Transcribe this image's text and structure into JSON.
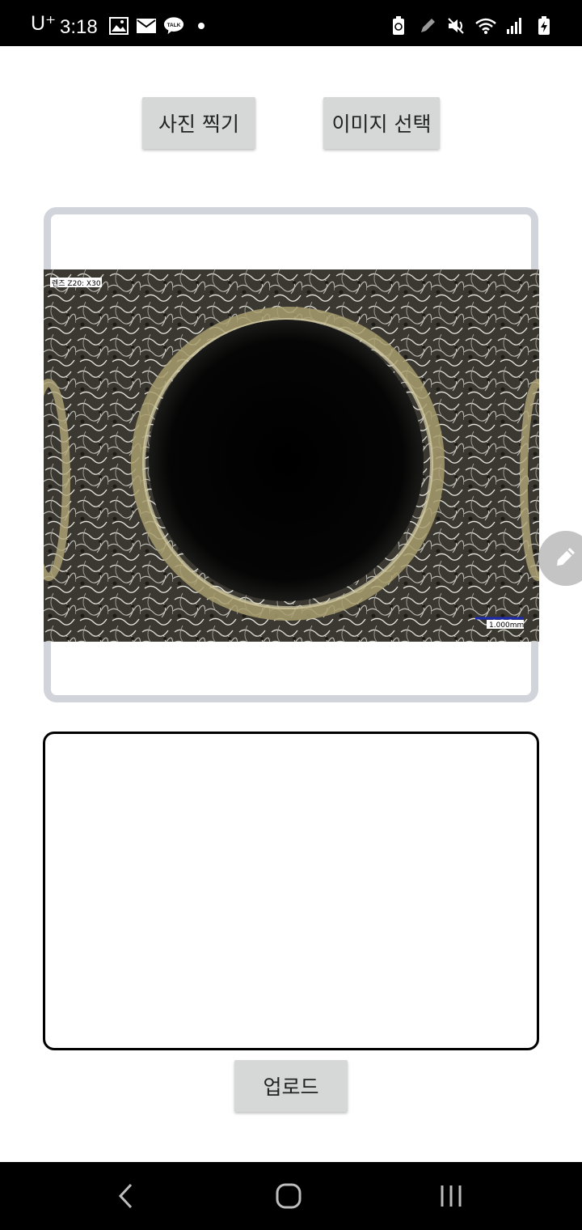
{
  "status_bar": {
    "carrier": "U⁺",
    "time": "3:18",
    "left_icons": [
      "gallery-icon",
      "email-icon",
      "kakaotalk-icon",
      "dot-icon"
    ],
    "right_icons": [
      "battery-saver-icon",
      "pen-icon",
      "mute-icon",
      "wifi-icon",
      "signal-icon",
      "battery-icon"
    ]
  },
  "toolbar": {
    "camera_label": "사진 찍기",
    "select_label": "이미지 선택"
  },
  "preview": {
    "caption": "렌즈 Z20: X30",
    "scale_label": "1.000mm"
  },
  "description": {
    "value": "",
    "placeholder": ""
  },
  "upload": {
    "label": "업로드"
  },
  "colors": {
    "button_bg": "#d6d7d7",
    "frame_border": "#d1d5db",
    "fab_bg": "#c4c4c4",
    "status_bar_bg": "#000000",
    "nav_bar_bg": "#000000",
    "scale_bar": "#1e2ab0"
  },
  "nav_bar": {
    "icons": [
      "back-icon",
      "home-icon",
      "recent-apps-icon"
    ]
  }
}
